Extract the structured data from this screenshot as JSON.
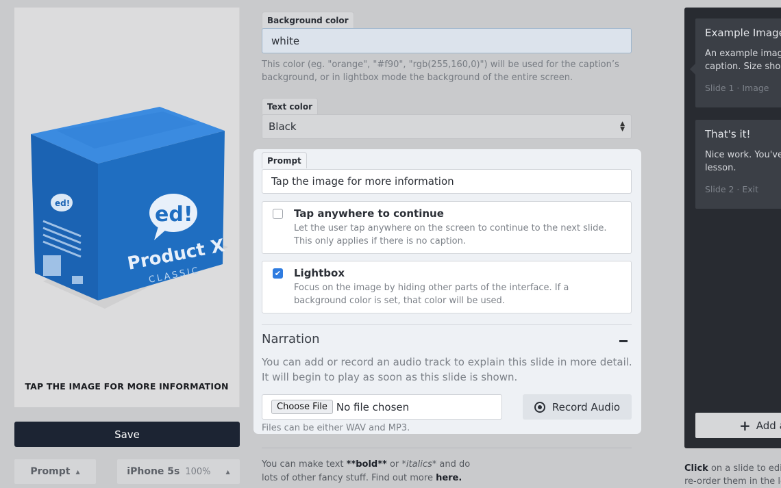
{
  "preview": {
    "product_name": "Product X",
    "product_subtitle": "CLASSIC",
    "logo_text": "ed!",
    "caption": "TAP THE IMAGE FOR MORE INFORMATION",
    "save_label": "Save",
    "prompt_button_label": "Prompt",
    "device_label": "iPhone 5s",
    "zoom_label": "100%"
  },
  "form": {
    "background_color": {
      "label": "Background color",
      "value": "white",
      "help": "This color (eg. \"orange\", \"#f90\", \"rgb(255,160,0)\") will be used for the caption’s background, or in lightbox mode the background of the entire screen."
    },
    "text_color": {
      "label": "Text color",
      "value": "Black"
    },
    "prompt": {
      "label": "Prompt",
      "value": "Tap the image for more information"
    },
    "options": [
      {
        "title": "Tap anywhere to continue",
        "description": "Let the user tap anywhere on the screen to continue to the next slide. This only applies if there is no caption.",
        "checked": false
      },
      {
        "title": "Lightbox",
        "description": "Focus on the image by hiding other parts of the interface. If a background color is set, that color will be used.",
        "checked": true
      }
    ],
    "narration": {
      "title": "Narration",
      "collapse_symbol": "–",
      "description": "You can add or record an audio track to explain this slide in more detail. It will begin to play as soon as this slide is shown.",
      "choose_file_label": "Choose File",
      "no_file_text": "No file chosen",
      "record_label": "Record Audio",
      "files_note": "Files can be either WAV and MP3."
    },
    "markdown_note": {
      "line1_pre": "You can make text ",
      "bold_sample": "**bold**",
      "or": " or ",
      "italic_sample": "*italics*",
      "line1_post": " and do",
      "line2_pre": "lots of other fancy stuff. Find out more ",
      "link": "here."
    }
  },
  "slides": {
    "items": [
      {
        "title": "Example Image",
        "description_line1": "An example image",
        "description_line2": "caption. Size shou",
        "meta": "Slide 1 · Image"
      },
      {
        "title": "That's it!",
        "description_line1": "Nice work. You've",
        "description_line2": "lesson.",
        "meta": "Slide 2 · Exit"
      }
    ],
    "add_label": "Add a",
    "note_bold": "Click",
    "note_line1": " on a slide to edit. I",
    "note_line2": "re-order them in the les"
  },
  "colors": {
    "box_blue": "#1f6ec1",
    "save_dark": "#1c2433",
    "checkbox_blue": "#2f7ce0"
  }
}
